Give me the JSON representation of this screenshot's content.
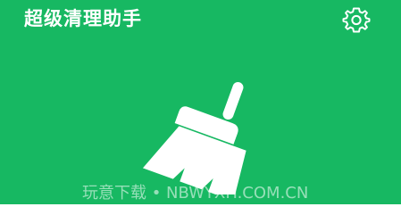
{
  "header": {
    "title": "超级清理助手",
    "settings_icon": "gear-icon"
  },
  "hero": {
    "icon": "broom-icon"
  },
  "watermark": {
    "text": "玩意下载 • NBWYXH.COM.CN"
  },
  "colors": {
    "background": "#17b862",
    "foreground": "#ffffff"
  }
}
